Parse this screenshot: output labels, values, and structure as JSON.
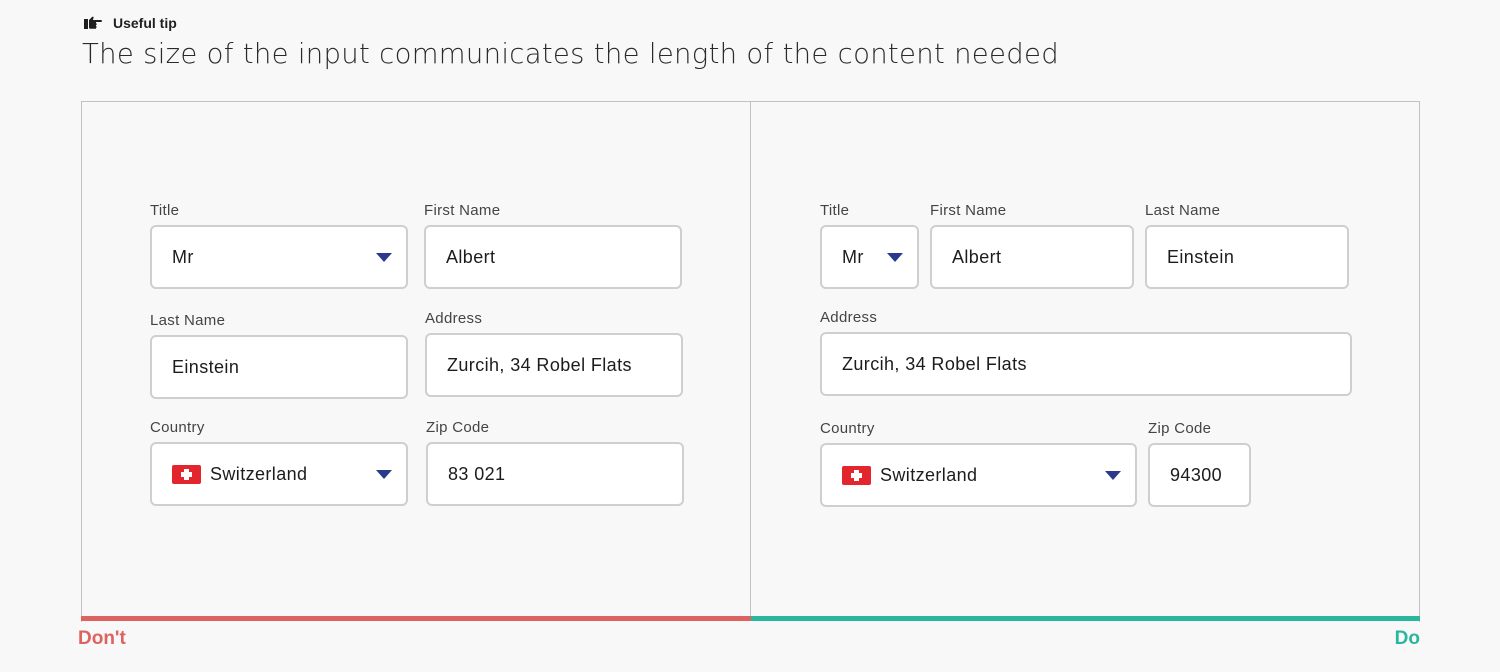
{
  "tip": {
    "icon": "pointing-hand-icon",
    "label": "Useful tip",
    "headline": "The size of the input communicates the length of the content needed"
  },
  "dont": {
    "verdict": "Don't",
    "color": "#dd6360",
    "title": {
      "label": "Title",
      "value": "Mr"
    },
    "first_name": {
      "label": "First Name",
      "value": "Albert"
    },
    "last_name": {
      "label": "Last Name",
      "value": "Einstein"
    },
    "address": {
      "label": "Address",
      "value": "Zurcih, 34 Robel Flats"
    },
    "country": {
      "label": "Country",
      "value": "Switzerland",
      "flag": "swiss-flag-icon"
    },
    "zip": {
      "label": "Zip Code",
      "value": "83 021"
    }
  },
  "do": {
    "verdict": "Do",
    "color": "#2bb79d",
    "title": {
      "label": "Title",
      "value": "Mr"
    },
    "first_name": {
      "label": "First Name",
      "value": "Albert"
    },
    "last_name": {
      "label": "Last Name",
      "value": "Einstein"
    },
    "address": {
      "label": "Address",
      "value": "Zurcih, 34 Robel Flats"
    },
    "country": {
      "label": "Country",
      "value": "Switzerland",
      "flag": "swiss-flag-icon"
    },
    "zip": {
      "label": "Zip Code",
      "value": "94300"
    }
  },
  "colors": {
    "caret": "#2c3a8c",
    "input_border": "#cfcfcf",
    "frame_border": "#c2c2c2",
    "background": "#f8f8f8"
  }
}
